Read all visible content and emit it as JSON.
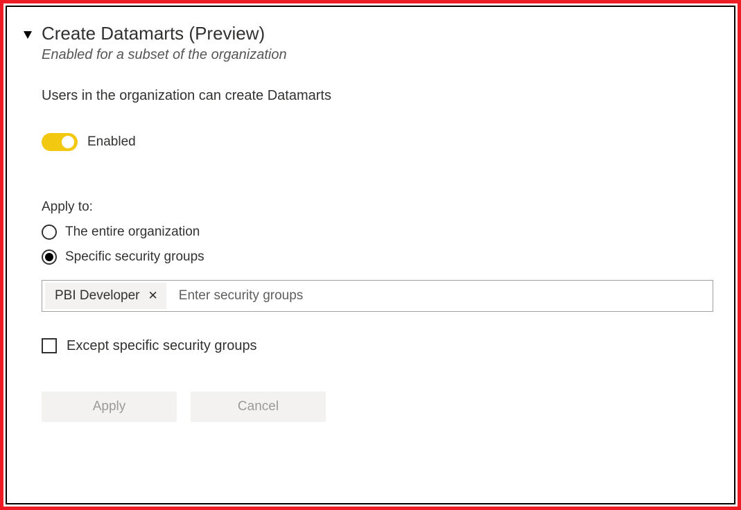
{
  "colors": {
    "accent": "#f2c811",
    "frame": "#ed1c24"
  },
  "setting": {
    "title": "Create Datamarts (Preview)",
    "subtitle": "Enabled for a subset of the organization",
    "description": "Users in the organization can create Datamarts",
    "toggle": {
      "enabled": true,
      "label": "Enabled"
    },
    "applyTo": {
      "label": "Apply to:",
      "options": [
        {
          "label": "The entire organization",
          "selected": false
        },
        {
          "label": "Specific security groups",
          "selected": true
        }
      ]
    },
    "securityGroups": {
      "chips": [
        {
          "label": "PBI Developer"
        }
      ],
      "placeholder": "Enter security groups"
    },
    "except": {
      "checked": false,
      "label": "Except specific security groups"
    },
    "buttons": {
      "apply": "Apply",
      "cancel": "Cancel"
    }
  }
}
